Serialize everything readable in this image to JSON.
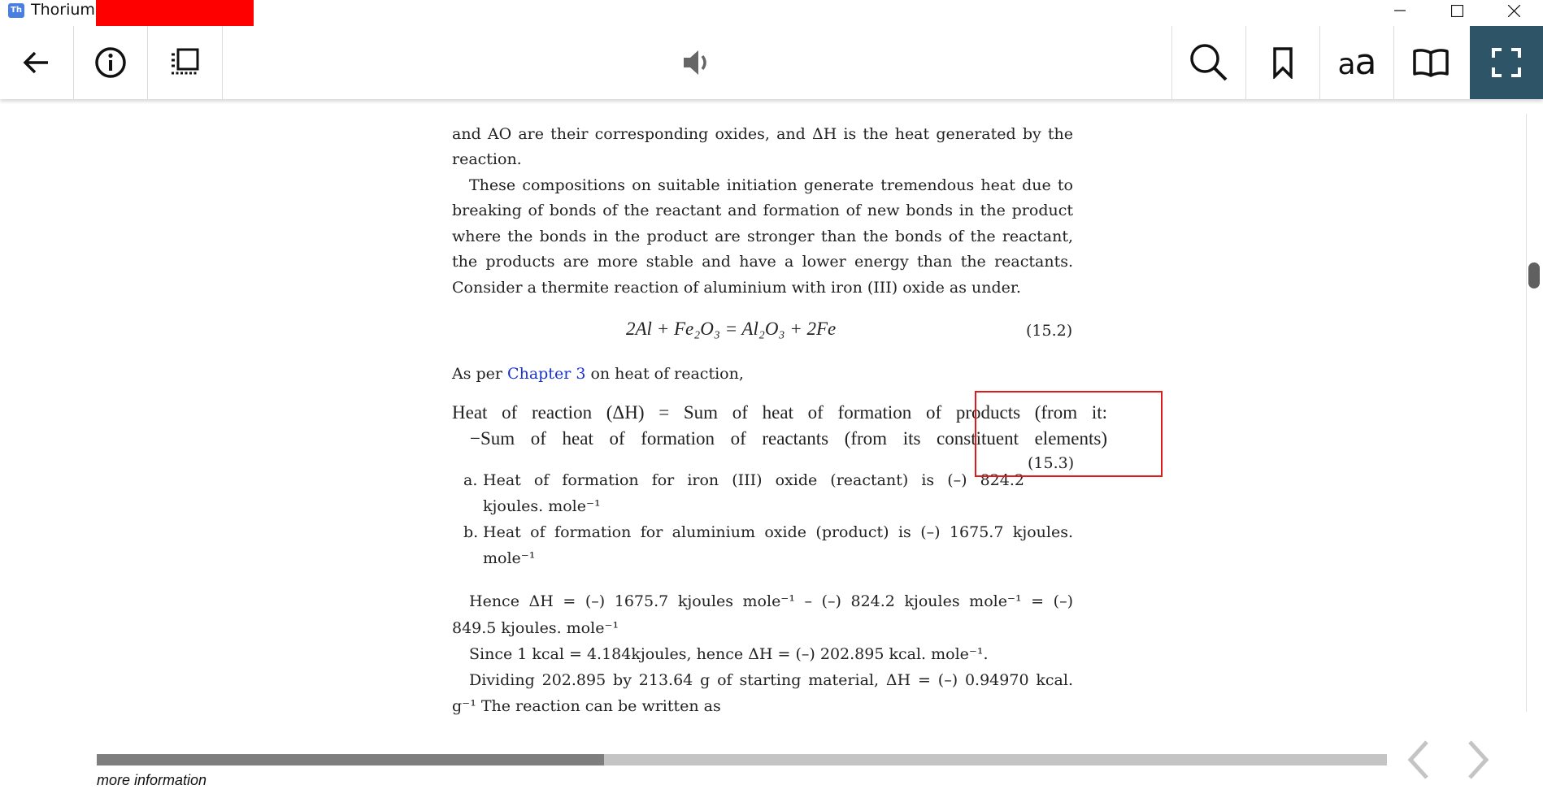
{
  "window": {
    "app_name": "Thorium -",
    "app_icon_label": "Th",
    "controls": [
      "minimize-icon",
      "maximize-icon",
      "close-icon"
    ]
  },
  "toolbar": {
    "left": [
      "back-arrow-icon",
      "info-icon",
      "toc-list-icon"
    ],
    "center": [
      "speaker-icon"
    ],
    "right": [
      "search-icon",
      "bookmark-icon",
      "text-settings-icon",
      "reading-mode-icon",
      "fullscreen-icon"
    ],
    "text_settings_label_small": "a",
    "text_settings_label_large": "a",
    "active_color": "#2e5467"
  },
  "content": {
    "p1_l1": "and AO are their corresponding oxides, and ΔH is the heat generated by the",
    "p1_l2": "reaction.",
    "p2_l1": "These compositions on suitable initiation generate tremendous heat due to",
    "p2_l2": "breaking of bonds of the reactant and formation of new bonds in the product",
    "p2_l3": "where the bonds in the product are stronger than the bonds of the reactant,",
    "p2_l4": "the products are more stable and have a lower energy than the reactants.",
    "p2_l5": "Consider a thermite reaction of aluminium with iron (III) oxide as under.",
    "eq1": "2Al + Fe₂O₃ = Al₂O₃ + 2Fe",
    "eq1_num": "(15.2)",
    "as_per_prefix": "As per ",
    "as_per_link": "Chapter 3",
    "as_per_suffix": " on heat of reaction,",
    "eq2_l1": "Heat of reaction (ΔH) = Sum of heat of formation of products (from it:",
    "eq2_l2": "−Sum of heat of formation of reactants (from its constituent elements)",
    "eq2_num": "(15.3)",
    "item_a_marker": "a.",
    "item_a_l1": "Heat of formation for iron (III) oxide (reactant) is (–) 824.2",
    "item_a_l2": "kjoules. mole⁻¹",
    "item_b_marker": "b.",
    "item_b_l1": "Heat of formation for aluminium oxide (product) is (–) 1675.7 kjoules.",
    "item_b_l2": "mole⁻¹",
    "hence_l1": "Hence ΔH = (–) 1675.7 kjoules mole⁻¹ – (–) 824.2 kjoules mole⁻¹ = (–)",
    "hence_l2": "849.5 kjoules. mole⁻¹",
    "since": "Since 1 kcal = 4.184kjoules, hence ΔH = (–) 202.895 kcal. mole⁻¹.",
    "div_l1": "Dividing 202.895 by 213.64 g of starting material, ΔH = (–) 0.94970 kcal.",
    "div_l2": "g⁻¹ The reaction can be written as"
  },
  "footer": {
    "progress_fraction": 0.393,
    "more_info": "more information",
    "prev": "chevron-left-icon",
    "next": "chevron-right-icon"
  },
  "scroll": {
    "position_fraction": 0.2
  },
  "colors": {
    "link": "#1a33cc",
    "highlight_box": "#e01a1a",
    "redaction": "#ff0000"
  }
}
